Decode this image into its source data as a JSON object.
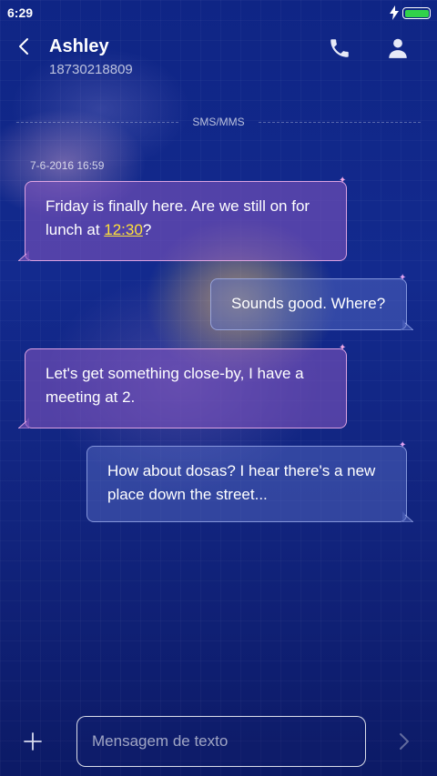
{
  "status_bar": {
    "time": "6:29",
    "battery_level": 1.0,
    "charging": true,
    "battery_color": "#31d24a"
  },
  "header": {
    "contact_name": "Ashley",
    "contact_number": "18730218809"
  },
  "conversation": {
    "channel_label": "SMS/MMS",
    "timestamp": "7-6-2016 16:59",
    "messages": [
      {
        "direction": "incoming",
        "text_before": "Friday is finally here. Are we still on for lunch at ",
        "link": "12:30",
        "text_after": "?"
      },
      {
        "direction": "outgoing",
        "text": "Sounds good. Where?"
      },
      {
        "direction": "incoming",
        "text": "Let's get something close-by, I have a meeting at 2."
      },
      {
        "direction": "outgoing",
        "text": "How about dosas? I hear there's a new place down the street..."
      }
    ]
  },
  "composer": {
    "placeholder": "Mensagem de texto"
  },
  "icons": {
    "back": "chevron-left-icon",
    "call": "phone-icon",
    "contact": "person-icon",
    "attach": "plus-icon",
    "send": "chevron-right-icon",
    "decoration": "sparkle-icon"
  },
  "colors": {
    "link": "#ffe13a",
    "incoming_border": "#f5b4eb",
    "outgoing_border": "#b9c8ff"
  }
}
